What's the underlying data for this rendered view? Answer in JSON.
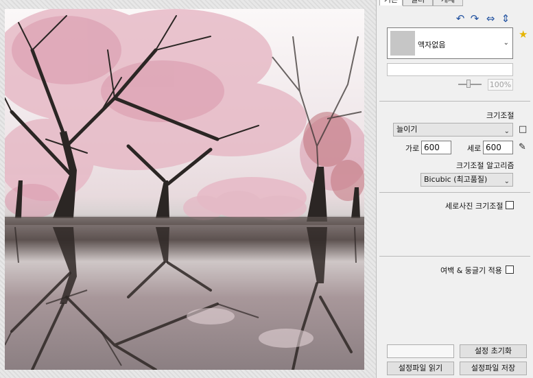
{
  "tabs": [
    {
      "label": "기본",
      "active": true
    },
    {
      "label": "필터",
      "active": false
    },
    {
      "label": "개체",
      "active": false
    }
  ],
  "toolbar": {
    "icons": [
      "undo-icon",
      "redo-icon",
      "flip-horizontal-icon",
      "flip-vertical-icon"
    ],
    "glyphs": [
      "↶",
      "↷",
      "⇔",
      "⇕"
    ],
    "favorite_glyph": "★"
  },
  "frame": {
    "selected": "액자없음",
    "zoom_value": "100%"
  },
  "resize": {
    "section_title": "크기조절",
    "mode": "늘이기",
    "width_label": "가로",
    "width_value": "600",
    "height_label": "세로",
    "height_value": "600",
    "algorithm_title": "크기조절 알고리즘",
    "algorithm": "Bicubic (최고품질)"
  },
  "portrait": {
    "label": "세로사진 크기조절",
    "checked": false
  },
  "margin": {
    "label": "여백 & 둥글기 적용",
    "checked": false
  },
  "buttons": {
    "reset": "설정 초기화",
    "load": "설정파일 읽기",
    "save": "설정파일 저장"
  },
  "colors": {
    "accent_icon": "#1e4f9e",
    "star": "#e5b400"
  }
}
